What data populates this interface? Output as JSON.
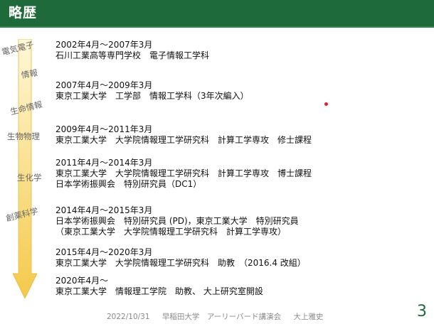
{
  "slide": {
    "title": "略歴",
    "topics": [
      "電気電子",
      "情報",
      "生命情報",
      "生物物理",
      "生化学",
      "創薬科学"
    ],
    "entries": [
      {
        "lines": [
          "2002年4月～2007年3月",
          "石川工業高等専門学校　電子情報工学科"
        ]
      },
      {
        "lines": [
          "2007年4月～2009年3月",
          "東京工業大学　工学部　情報工学科（3年次編入）"
        ]
      },
      {
        "lines": [
          "2009年4月～2011年3月",
          "東京工業大学　大学院情報理工学研究科　計算工学専攻　修士課程"
        ]
      },
      {
        "lines": [
          "2011年4月～2014年3月",
          "東京工業大学　大学院情報理工学研究科　計算工学専攻　博士課程",
          "日本学術振興会　特別研究員（DC1）"
        ]
      },
      {
        "lines": [
          "2014年4月～2015年3月",
          "日本学術振興会　特別研究員 (PD)，東京工業大学　特別研究員",
          "（東京工業大学　大学院情報理工学研究科　計算工学専攻）"
        ]
      },
      {
        "lines": [
          "2015年4月～2020年3月",
          "東京工業大学　大学院情報理工学研究科　助教　（2016.4 改組）"
        ]
      },
      {
        "lines": [
          "2020年4月～",
          "東京工業大学　情報理工学院　助教、 大上研究室開設"
        ]
      }
    ],
    "footer": {
      "date": "2022/10/31",
      "event": "早稲田大学　アーリーバード講演会",
      "author": "大上雅史"
    },
    "page_number": "3",
    "colors": {
      "title_bar": "#1f6a3a",
      "arrow_top": "#fff6cf",
      "arrow_bottom": "#f4c94a"
    }
  }
}
